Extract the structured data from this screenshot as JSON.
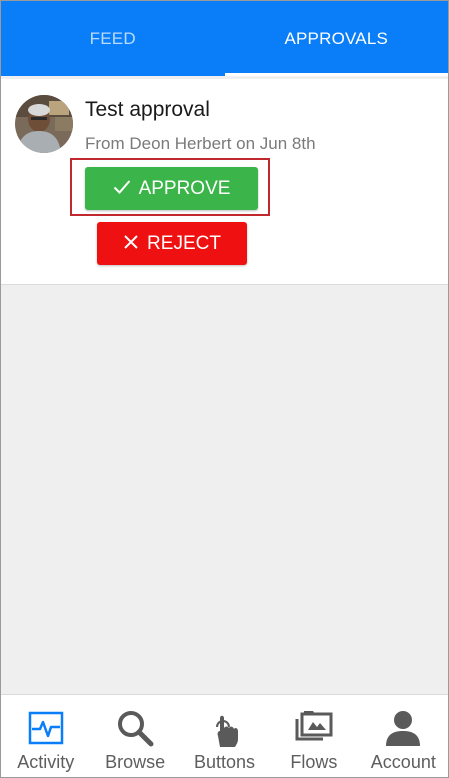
{
  "tabs": [
    {
      "label": "FEED",
      "active": false
    },
    {
      "label": "APPROVALS",
      "active": true
    }
  ],
  "colors": {
    "tabbar": "#0a7ef8",
    "approve": "#3bb54a",
    "reject": "#ef1111",
    "highlight": "#c0282e",
    "nav_active": "#0a7ef8",
    "nav_icon": "#5a5a5a"
  },
  "approval": {
    "title": "Test approval",
    "from": "From Deon Herbert on Jun 8th",
    "approve_label": "APPROVE",
    "reject_label": "REJECT",
    "approve_icon": "check-icon",
    "reject_icon": "close-icon"
  },
  "nav": [
    {
      "label": "Activity",
      "icon": "activity-icon",
      "active": true
    },
    {
      "label": "Browse",
      "icon": "search-icon",
      "active": false
    },
    {
      "label": "Buttons",
      "icon": "tap-icon",
      "active": false
    },
    {
      "label": "Flows",
      "icon": "flows-icon",
      "active": false
    },
    {
      "label": "Account",
      "icon": "person-icon",
      "active": false
    }
  ]
}
